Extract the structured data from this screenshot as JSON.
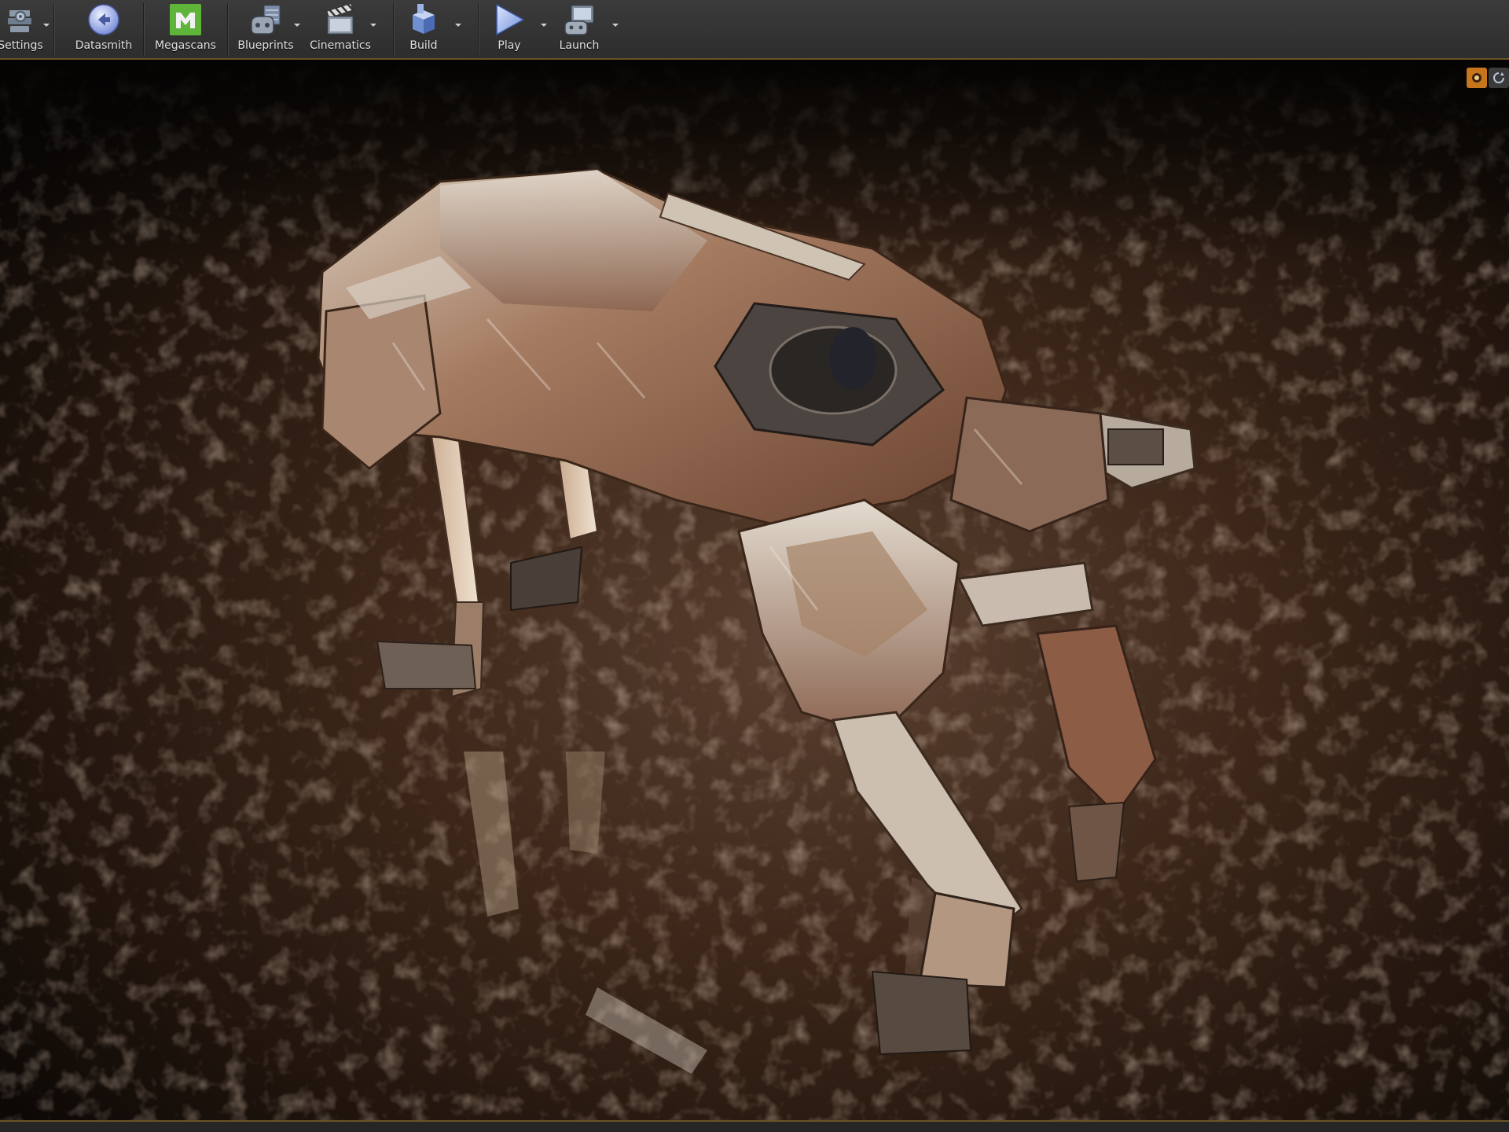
{
  "toolbar": {
    "items": [
      {
        "label": "Settings",
        "icon": "settings-icon",
        "has_dropdown": true
      },
      {
        "label": "Datasmith",
        "icon": "datasmith-icon",
        "has_dropdown": false
      },
      {
        "label": "Megascans",
        "icon": "megascans-icon",
        "has_dropdown": false
      },
      {
        "label": "Blueprints",
        "icon": "blueprints-icon",
        "has_dropdown": true
      },
      {
        "label": "Cinematics",
        "icon": "cinematics-icon",
        "has_dropdown": true
      },
      {
        "label": "Build",
        "icon": "build-icon",
        "has_dropdown": true
      },
      {
        "label": "Play",
        "icon": "play-icon",
        "has_dropdown": true
      },
      {
        "label": "Launch",
        "icon": "launch-icon",
        "has_dropdown": true
      }
    ]
  },
  "viewport": {
    "subject": "robot-dog-model",
    "controls": [
      "realtime-toggle-icon",
      "refresh-icon"
    ]
  },
  "colors": {
    "toolbar_bg": "#343434",
    "accent_border": "#6a5426",
    "megascans_green": "#5fb53a",
    "active_control": "#c8761c"
  }
}
